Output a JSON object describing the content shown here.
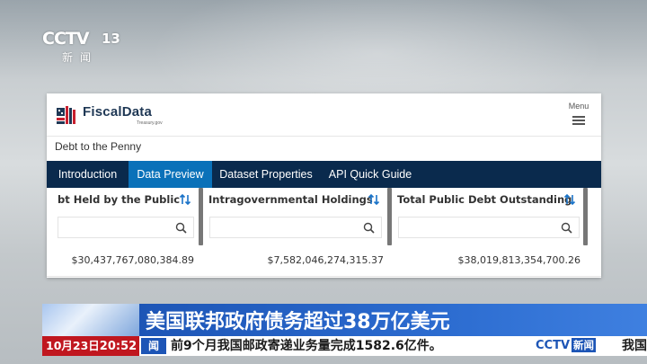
{
  "broadcast": {
    "logo_mark": "CCTV",
    "channel": "13",
    "logo_sub": "新闻"
  },
  "site": {
    "brand": "FiscalData",
    "brand_sub": "Treasury.gov",
    "menu_label": "Menu",
    "breadcrumb": "Debt to the Penny",
    "tabs": [
      {
        "label": "Introduction",
        "active": false
      },
      {
        "label": "Data Preview",
        "active": true
      },
      {
        "label": "Dataset Properties",
        "active": false
      },
      {
        "label": "API Quick Guide",
        "active": false
      }
    ],
    "table": {
      "columns": [
        {
          "header": "Debt Held by the Public",
          "header_visible": "bt Held by the Public",
          "filter_value": "",
          "value": "$30,437,767,080,384.89"
        },
        {
          "header": "Intragovernmental Holdings",
          "header_visible": "Intragovernmental Holdings",
          "filter_value": "",
          "value": "$7,582,046,274,315.37"
        },
        {
          "header": "Total Public Debt Outstanding",
          "header_visible": "Total Public Debt Outstanding",
          "filter_value": "",
          "value": "$38,019,813,354,700.26"
        }
      ]
    }
  },
  "ticker": {
    "headline": "美国联邦政府债务超过38万亿美元",
    "date": "10月23日",
    "time": "20:52",
    "label": "新闻",
    "label_visible": "闻",
    "text": "前9个月我国邮政寄递业务量完成1582.6亿件。",
    "logo_mark": "CCTV",
    "logo_news": "新闻",
    "tail_text": "我国"
  },
  "colors": {
    "nav_bg": "#0a2a4d",
    "active_tab": "#0a71b9",
    "sort_icon": "#1a73c8",
    "headline_bg": "#1d55b6",
    "date_bg": "#c0171f"
  }
}
